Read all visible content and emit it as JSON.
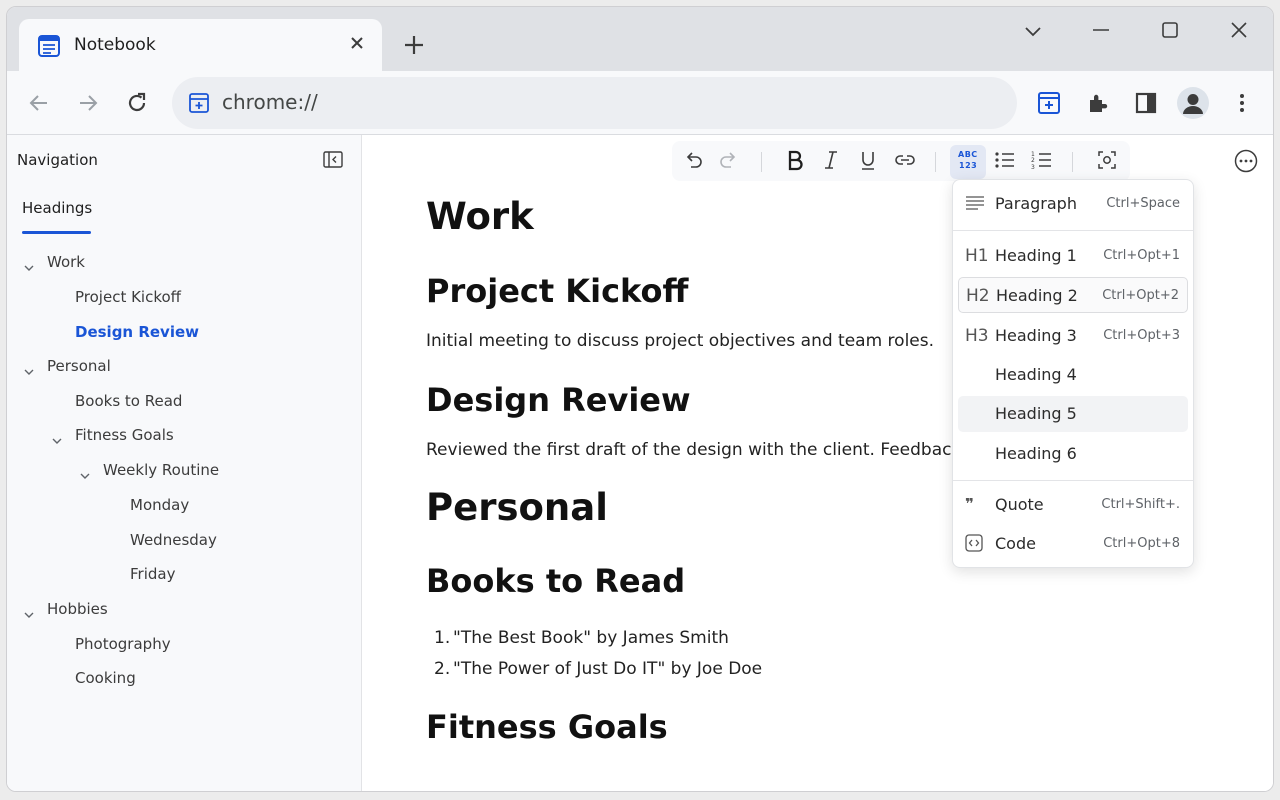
{
  "browser": {
    "tab_title": "Notebook",
    "address": "chrome://"
  },
  "sidebar": {
    "title": "Navigation",
    "tab_label": "Headings",
    "items": [
      {
        "label": "Work"
      },
      {
        "label": "Project Kickoff"
      },
      {
        "label": "Design Review"
      },
      {
        "label": "Personal"
      },
      {
        "label": "Books to Read"
      },
      {
        "label": "Fitness Goals"
      },
      {
        "label": "Weekly Routine"
      },
      {
        "label": "Monday"
      },
      {
        "label": "Wednesday"
      },
      {
        "label": "Friday"
      },
      {
        "label": "Hobbies"
      },
      {
        "label": "Photography"
      },
      {
        "label": "Cooking"
      }
    ]
  },
  "document": {
    "h_work": "Work",
    "h_kickoff": "Project Kickoff",
    "p_kickoff": "Initial meeting to discuss project objectives and team roles.",
    "h_design": "Design Review",
    "p_design": "Reviewed the first draft of the design with the client. Feedback colle",
    "h_personal": "Personal",
    "h_books": "Books to Read",
    "books": [
      "\"The Best Book\" by James Smith",
      "\"The Power of Just Do IT\" by Joe Doe"
    ],
    "book_numbers": [
      "1.",
      "2."
    ],
    "h_fitness": "Fitness Goals"
  },
  "format_menu": {
    "items": [
      {
        "icon": "≡",
        "label": "Paragraph",
        "shortcut": "Ctrl+Space"
      },
      {
        "icon": "H1",
        "label": "Heading 1",
        "shortcut": "Ctrl+Opt+1"
      },
      {
        "icon": "H2",
        "label": "Heading 2",
        "shortcut": "Ctrl+Opt+2"
      },
      {
        "icon": "H3",
        "label": "Heading 3",
        "shortcut": "Ctrl+Opt+3"
      },
      {
        "icon": "",
        "label": "Heading 4",
        "shortcut": ""
      },
      {
        "icon": "",
        "label": "Heading 5",
        "shortcut": ""
      },
      {
        "icon": "",
        "label": "Heading 6",
        "shortcut": ""
      },
      {
        "icon": "99",
        "label": "Quote",
        "shortcut": "Ctrl+Shift+."
      },
      {
        "icon": "<>",
        "label": "Code",
        "shortcut": "Ctrl+Opt+8"
      }
    ]
  },
  "fmt_toolbar": {
    "block_type_glyph_top": "ABC",
    "block_type_glyph_bottom": "123"
  },
  "colors": {
    "accent": "#1a55d6",
    "sidebar_bg": "#f8f9fb"
  }
}
